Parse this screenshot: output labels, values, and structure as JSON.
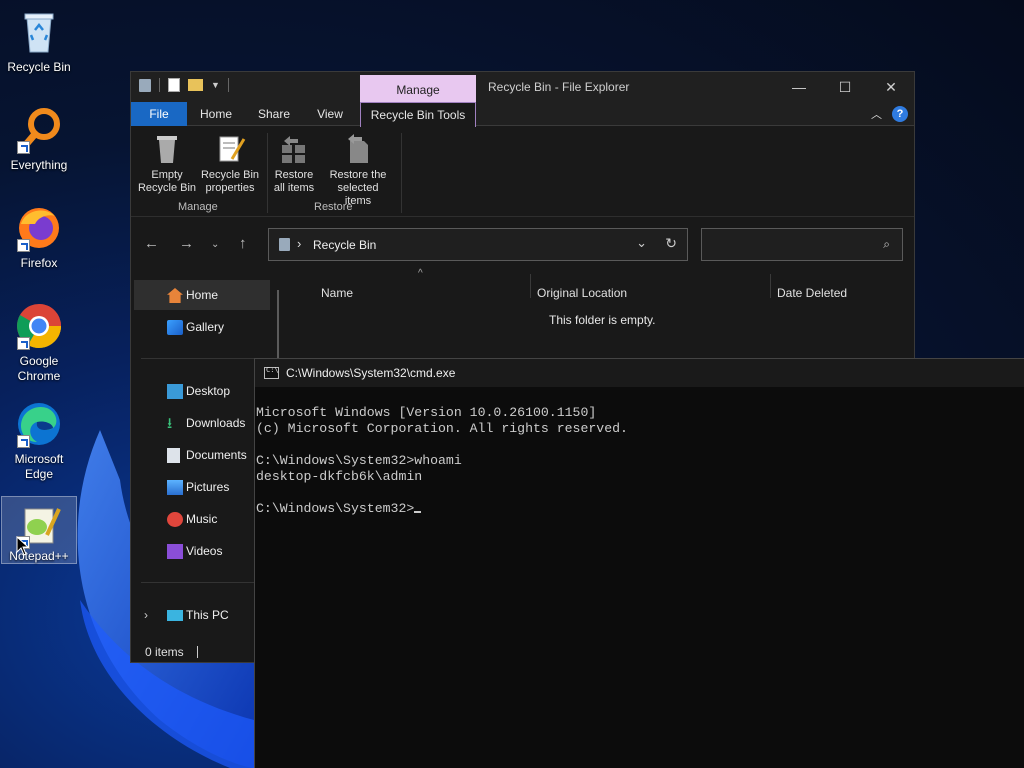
{
  "desktop": {
    "icons": [
      {
        "name": "recycle-bin",
        "label": "Recycle Bin"
      },
      {
        "name": "everything",
        "label": "Everything"
      },
      {
        "name": "firefox",
        "label": "Firefox"
      },
      {
        "name": "google-chrome",
        "label": "Google Chrome"
      },
      {
        "name": "microsoft-edge",
        "label": "Microsoft Edge"
      },
      {
        "name": "notepad-plus-plus",
        "label": "Notepad++"
      }
    ]
  },
  "explorer": {
    "title": "Recycle Bin - File Explorer",
    "context_tab": "Manage",
    "tabs": [
      "File",
      "Home",
      "Share",
      "View",
      "Recycle Bin Tools"
    ],
    "ribbon": {
      "manage_group": "Manage",
      "restore_group": "Restore",
      "empty_bin": [
        "Empty",
        "Recycle Bin"
      ],
      "properties": [
        "Recycle Bin",
        "properties"
      ],
      "restore_all": [
        "Restore",
        "all items"
      ],
      "restore_selected": [
        "Restore the",
        "selected items"
      ]
    },
    "address": "Recycle Bin",
    "search_placeholder": "",
    "sidebar": {
      "home": "Home",
      "gallery": "Gallery",
      "desktop": "Desktop",
      "downloads": "Downloads",
      "documents": "Documents",
      "pictures": "Pictures",
      "music": "Music",
      "videos": "Videos",
      "this_pc": "This PC"
    },
    "columns": [
      "Name",
      "Original Location",
      "Date Deleted"
    ],
    "empty_message": "This folder is empty.",
    "status": "0 items"
  },
  "cmd": {
    "title": "C:\\Windows\\System32\\cmd.exe",
    "lines": [
      "Microsoft Windows [Version 10.0.26100.1150]",
      "(c) Microsoft Corporation. All rights reserved.",
      "",
      "C:\\Windows\\System32>whoami",
      "desktop-dkfcb6k\\admin",
      ""
    ],
    "prompt": "C:\\Windows\\System32>"
  },
  "colors": {
    "accent_blue": "#1968c4",
    "manage_tab": "#e8c8f0",
    "window_dark": "#191919",
    "console_bg": "#0c0c0c"
  }
}
